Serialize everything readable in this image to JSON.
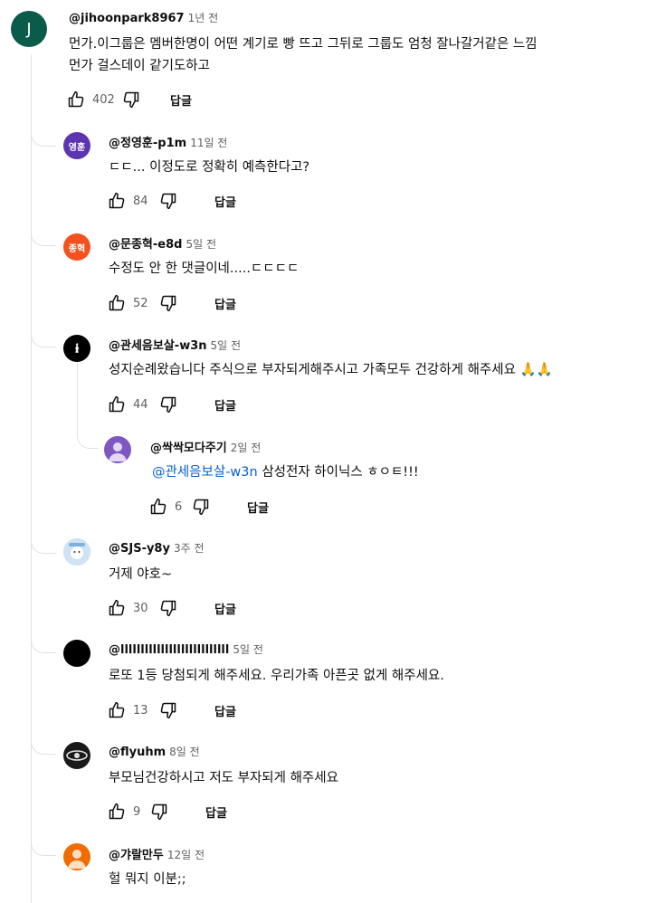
{
  "top_comment": {
    "author": "@jihoonpark8967",
    "time": "1년 전",
    "avatar_letter": "J",
    "avatar_color": "#0b5b4a",
    "lines": [
      "먼가.이그룹은 멤버한명이 어떤 계기로 빵 뜨고 그뒤로 그룹도 엄청 잘나갈거같은 느낌",
      "먼가 걸스데이 같기도하고"
    ],
    "likes": "402",
    "reply_label": "답글"
  },
  "replies": [
    {
      "author": "@정영훈-p1m",
      "time": "11일 전",
      "avatar_text": "영훈",
      "avatar_color": "#5e35b1",
      "text": "ㄷㄷ... 이정도로 정확히 예측한다고?",
      "likes": "84",
      "reply_label": "답글"
    },
    {
      "author": "@문종혁-e8d",
      "time": "5일 전",
      "avatar_text": "종혁",
      "avatar_color": "#f4511e",
      "text": "수정도 안 한 댓글이네.....ㄷㄷㄷㄷ",
      "likes": "52",
      "reply_label": "답글"
    },
    {
      "author": "@관세음보살-w3n",
      "time": "5일 전",
      "avatar_text": "",
      "avatar_color": "#000000",
      "text": "성지순례왔습니다 주식으로 부자되게해주시고 가족모두 건강하게 해주세요 🙏🙏",
      "likes": "44",
      "reply_label": "답글"
    },
    {
      "author": "@싹싹모다주기",
      "time": "2일 전",
      "avatar_text": "",
      "avatar_color": "#7e57c2",
      "mention": "@관세음보살-w3n",
      "text": " 삼성전자 하이닉스 ㅎㅇㅌ!!!",
      "likes": "6",
      "reply_label": "답글"
    },
    {
      "author": "@SJS-y8y",
      "time": "3주 전",
      "avatar_text": "",
      "avatar_color": "#b3d4ef",
      "text": "거제 야호~",
      "likes": "30",
      "reply_label": "답글"
    },
    {
      "author": "@lllllllllllllllllllllllllll",
      "time": "5일 전",
      "avatar_text": "",
      "avatar_color": "#000000",
      "text": "로또 1등 당첨되게 해주세요. 우리가족 아픈곳 없게 해주세요.",
      "likes": "13",
      "reply_label": "답글"
    },
    {
      "author": "@flyuhm",
      "time": "8일 전",
      "avatar_text": "",
      "avatar_color": "#1a1a1a",
      "text": "부모님건강하시고 저도 부자되게 해주세요",
      "likes": "9",
      "reply_label": "답글"
    },
    {
      "author": "@갸랄만두",
      "time": "12일 전",
      "avatar_text": "",
      "avatar_color": "#ef6c00",
      "text": "헐 뭐지 이분;;",
      "likes": "",
      "reply_label": ""
    }
  ]
}
